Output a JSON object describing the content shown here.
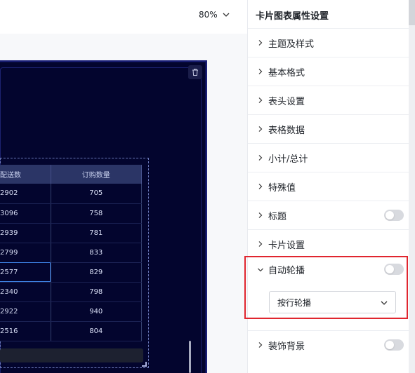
{
  "toolbar": {
    "zoom_label": "80%"
  },
  "table": {
    "headers": [
      "配送数",
      "订购数量"
    ],
    "rows": [
      [
        "2902",
        "705"
      ],
      [
        "3096",
        "758"
      ],
      [
        "2939",
        "781"
      ],
      [
        "2799",
        "833"
      ],
      [
        "2577",
        "829"
      ],
      [
        "2340",
        "798"
      ],
      [
        "2922",
        "940"
      ],
      [
        "2516",
        "804"
      ]
    ],
    "selected_cell": "2577"
  },
  "panel": {
    "title": "卡片图表属性设置",
    "items": [
      {
        "label": "主题及样式"
      },
      {
        "label": "基本格式"
      },
      {
        "label": "表头设置"
      },
      {
        "label": "表格数据"
      },
      {
        "label": "小计/总计"
      },
      {
        "label": "特殊值"
      },
      {
        "label": "标题",
        "toggle": "off"
      },
      {
        "label": "卡片设置"
      },
      {
        "label": "自动轮播",
        "toggle": "off",
        "expanded": true
      },
      {
        "label": "装饰背景",
        "toggle": "off"
      }
    ],
    "carousel_mode": "按行轮播"
  },
  "colors": {
    "highlight": "#e0262f",
    "canvas_bg": "#03052e"
  }
}
